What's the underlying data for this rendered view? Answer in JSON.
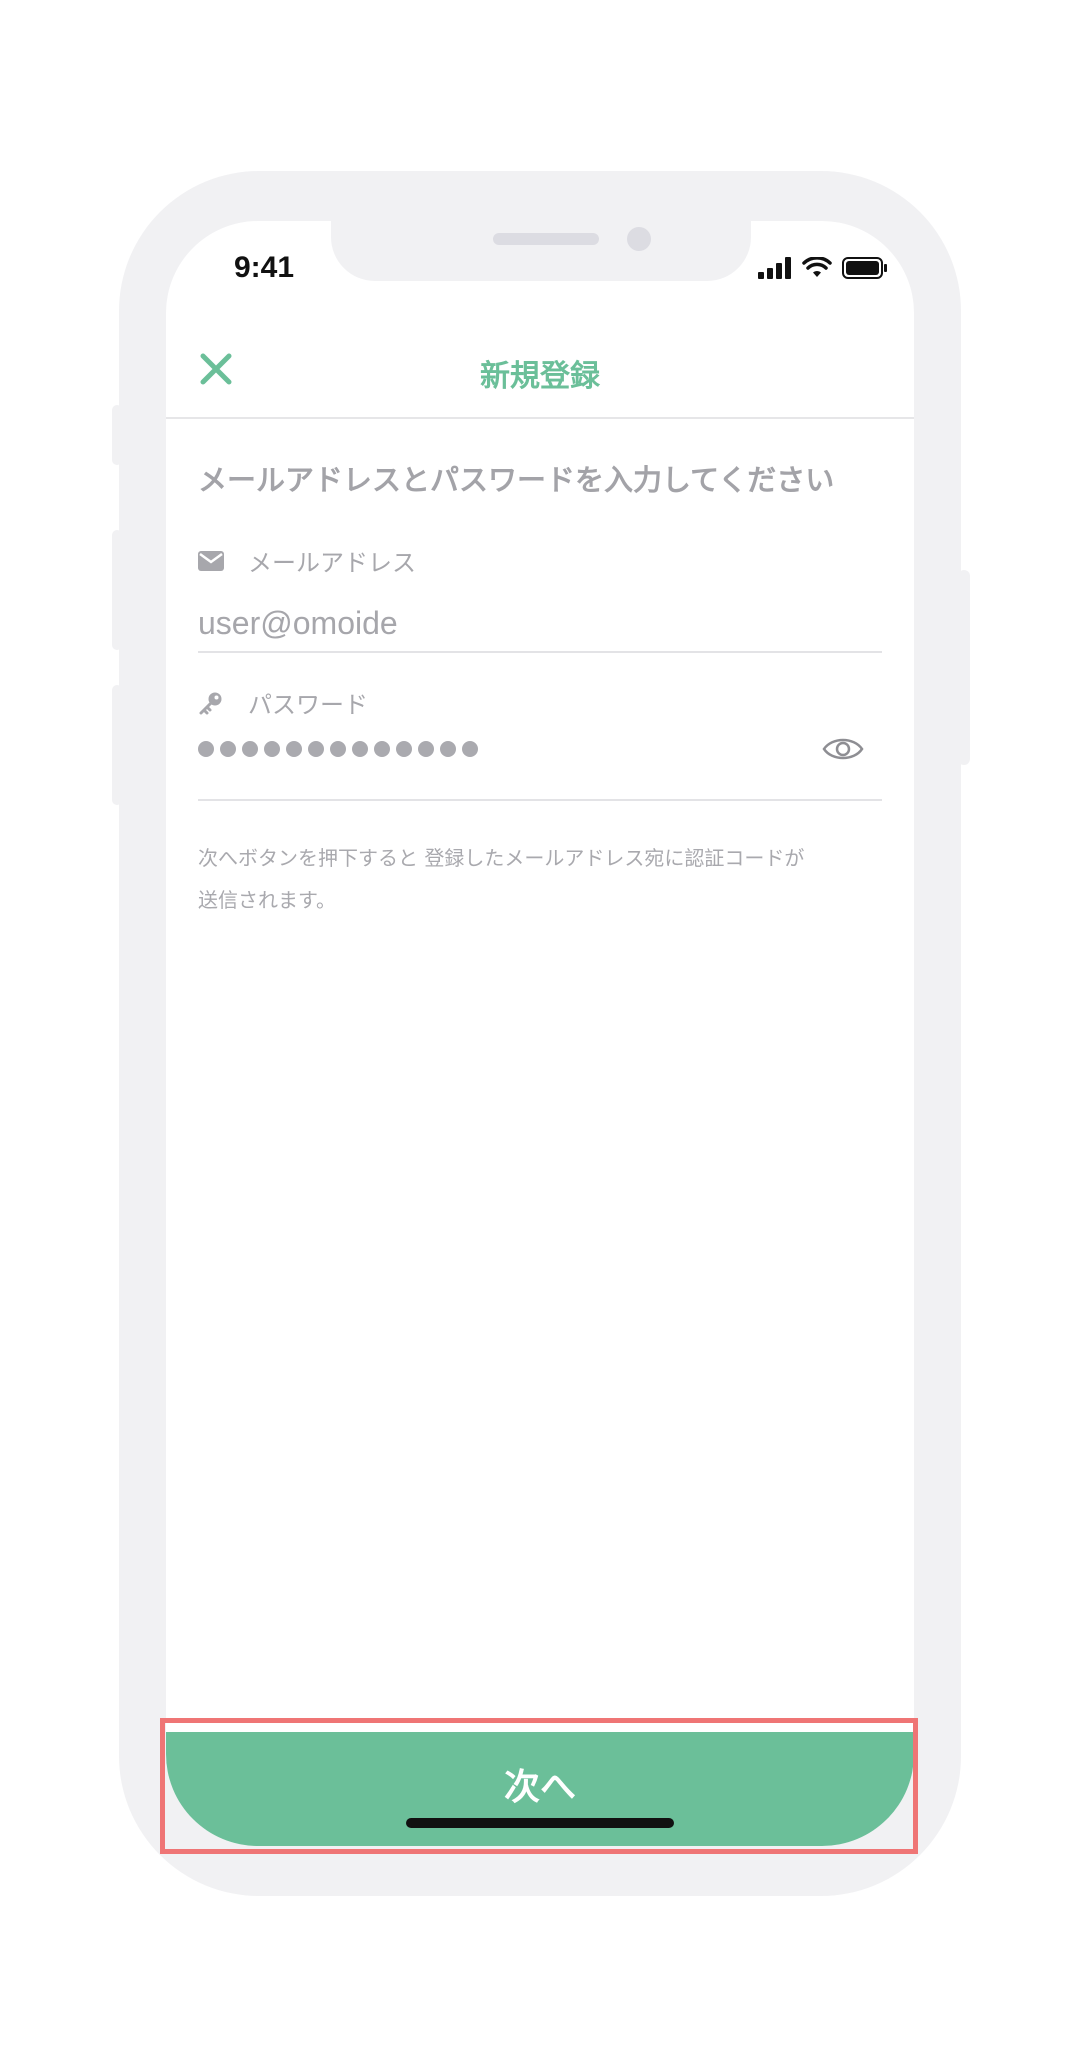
{
  "status_bar": {
    "time": "9:41"
  },
  "nav": {
    "title": "新規登録",
    "close_icon": "close-icon"
  },
  "main": {
    "instruction": "メールアドレスとパスワードを入力してください",
    "email": {
      "label": "メールアドレス",
      "value": "user@omoide",
      "icon": "mail-icon"
    },
    "password": {
      "label": "パスワード",
      "masked_length": 13,
      "icon": "key-icon",
      "toggle_icon": "eye-icon"
    },
    "note_line1": "次へボタンを押下すると 登録したメールアドレス宛に認証コードが",
    "note_line2": "送信されます。"
  },
  "footer": {
    "next_label": "次へ"
  },
  "colors": {
    "accent": "#6bbf99",
    "highlight": "#ef7575",
    "device": "#f1f1f3"
  }
}
